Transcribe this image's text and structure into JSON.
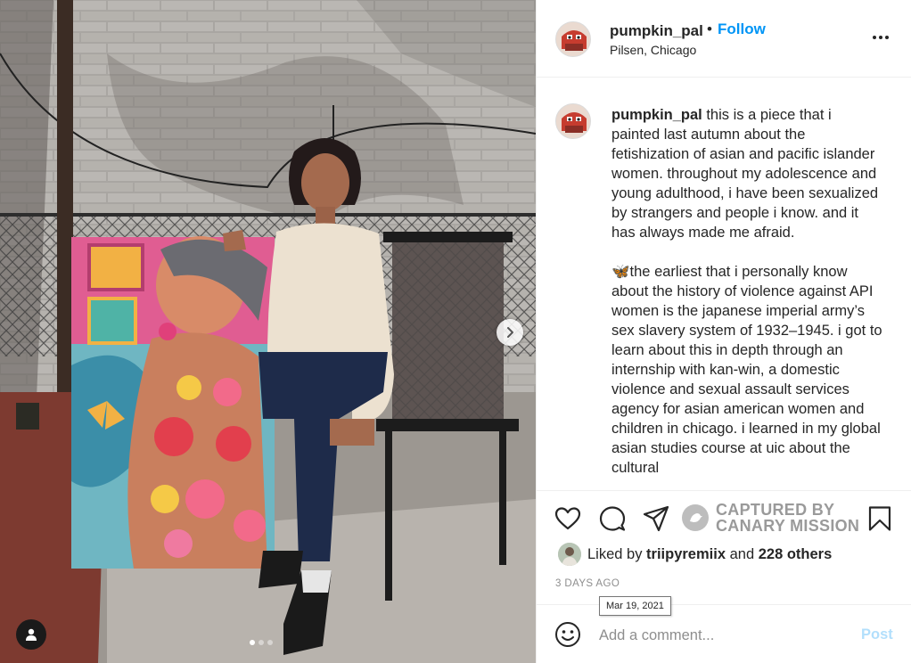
{
  "post": {
    "username": "pumpkin_pal",
    "follow_dot": "•",
    "follow_label": "Follow",
    "location": "Pilsen, Chicago"
  },
  "caption": {
    "username": "pumpkin_pal",
    "text": " this is a piece that i painted last autumn about the fetishization of asian and pacific islander women. throughout my adolescence and young adulthood, i have been sexualized by strangers and people i know. and it has always made me afraid.\n\n🦋the earliest that i personally know about the history of violence against API women is the japanese imperial army’s sex slavery system of 1932–1945. i got to learn about this in depth through an internship with kan-win, a domestic violence and sexual assault services agency for asian american women and children in chicago. i learned in my global asian studies course at uic about the cultural"
  },
  "actions": {
    "watermark_line1": "CAPTURED BY",
    "watermark_line2": "CANARY MISSION"
  },
  "likes": {
    "prefix": "Liked by ",
    "liker": "triipyremiix",
    "middle": " and ",
    "others": "228 others"
  },
  "timestamp": "3 DAYS AGO",
  "tooltip_date": "Mar 19, 2021",
  "comment": {
    "placeholder": "Add a comment...",
    "post_label": "Post"
  },
  "carousel": {
    "slides": 3,
    "active": 1
  },
  "icons": [
    "heart-icon",
    "comment-icon",
    "share-icon",
    "bookmark-icon",
    "emoji-icon",
    "more-icon",
    "chevron-right-icon",
    "user-tag-icon"
  ],
  "colors": {
    "follow": "#0095f6",
    "post_disabled": "#b2dffc",
    "text": "#262626",
    "muted": "#8e8e8e"
  }
}
